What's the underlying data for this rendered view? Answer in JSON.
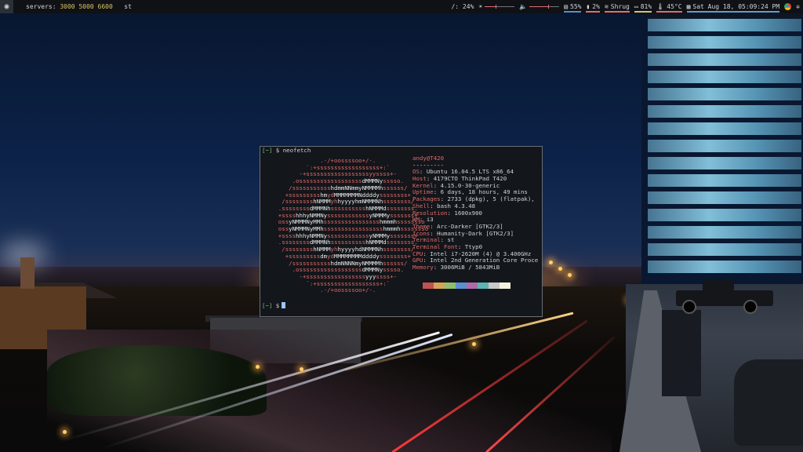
{
  "topbar": {
    "logo_glyph": "◉",
    "servers_label": "servers:",
    "ports": "3000 5000 6600",
    "layout": "st",
    "disk": "/: 24%",
    "brightness_level": 0.35,
    "volume_level": 0.62,
    "storage": "55%",
    "cpu": "2%",
    "wifi": "Shrug",
    "battery": "81%",
    "temp": "45°C",
    "datetime": "Sat Aug 18, 05:09:24 PM",
    "colors": {
      "storage": "#4f8fd6",
      "cpu": "#e06c75",
      "wifi": "#e06c75",
      "battery": "#d7c36a",
      "temp": "#e06c75",
      "datetime": "#5aa0d8"
    }
  },
  "terminal": {
    "command_prompt": "[~] $ neofetch",
    "final_prompt": "[~] $",
    "user_host": "andy@T420",
    "separator": "---------",
    "info": [
      {
        "key": "OS",
        "value": "Ubuntu 16.04.5 LTS x86_64"
      },
      {
        "key": "Host",
        "value": "4179CTO ThinkPad T420"
      },
      {
        "key": "Kernel",
        "value": "4.15.0-30-generic"
      },
      {
        "key": "Uptime",
        "value": "6 days, 18 hours, 49 mins"
      },
      {
        "key": "Packages",
        "value": "2733 (dpkg), 5 (flatpak),"
      },
      {
        "key": "Shell",
        "value": "bash 4.3.48"
      },
      {
        "key": "Resolution",
        "value": "1600x900"
      },
      {
        "key": "WM",
        "value": "i3"
      },
      {
        "key": "Theme",
        "value": "Arc-Darker [GTK2/3]"
      },
      {
        "key": "Icons",
        "value": "Humanity-Dark [GTK2/3]"
      },
      {
        "key": "Terminal",
        "value": "st"
      },
      {
        "key": "Terminal Font",
        "value": "Ttyp0"
      },
      {
        "key": "CPU",
        "value": "Intel i7-2620M (4) @ 3.400GHz"
      },
      {
        "key": "GPU",
        "value": "Intel 2nd Generation Core Proce"
      },
      {
        "key": "Memory",
        "value": "3006MiB / 5843MiB"
      }
    ],
    "palette": [
      "#c25252",
      "#d5a35a",
      "#8fbf6e",
      "#5a8fd0",
      "#b06aa8",
      "#5fb3b3",
      "#c8c8c8",
      "#f2f2dc"
    ]
  }
}
